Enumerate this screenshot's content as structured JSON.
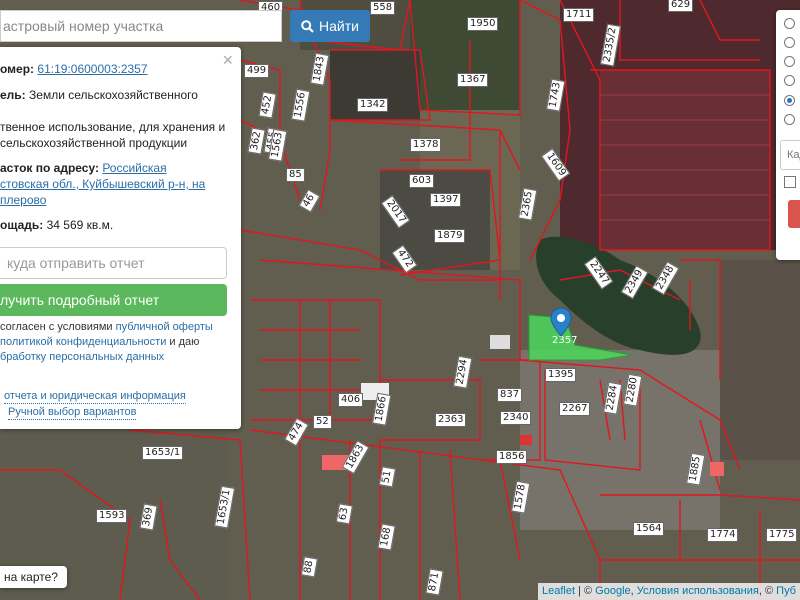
{
  "search": {
    "placeholder": "астровый номер участка",
    "button_label": "Найти"
  },
  "info": {
    "number_label": "омер:",
    "number_value": "61:19:0600003:2357",
    "purpose_label": "ель:",
    "purpose_value": "Земли сельскохозяйственного",
    "usage_line1": "твенное использование, для хранения и",
    "usage_line2": "сельскохозяйственной продукции",
    "address_label": "асток по адресу:",
    "address_l1": "Российская",
    "address_l2": "стовская обл., Куйбышевский р-н, на",
    "address_l3": "плерово",
    "area_label": "ощадь:",
    "area_value": "34 569 кв.м.",
    "email_placeholder": "куда отправить отчет",
    "report_button": "лучить подробный отчет",
    "agree_1a": "согласен с условиями ",
    "agree_1b": "публичной оферты",
    "agree_2a": "политикой конфиденциальности",
    "agree_2b": " и даю",
    "agree_3": "бработку персональных данных",
    "link_legal": "отчета и юридическая информация",
    "link_manual": "Ручной выбор вариантов"
  },
  "right_panel": {
    "input_placeholder": "Кад"
  },
  "bottom": {
    "where_label": "на карте?",
    "attr_leaflet": "Leaflet",
    "attr_google": "Google",
    "attr_terms": "Условия использования",
    "attr_pub": "Пуб"
  },
  "map": {
    "selected_plot": "2357",
    "plots": [
      {
        "t": "460",
        "s": "h"
      },
      {
        "t": "558",
        "s": "h"
      },
      {
        "t": "1950",
        "s": "h"
      },
      {
        "t": "1711",
        "s": "h"
      },
      {
        "t": "629",
        "s": "h"
      },
      {
        "t": "499",
        "s": "h"
      },
      {
        "t": "1843",
        "s": "v"
      },
      {
        "t": "1367",
        "s": "h"
      },
      {
        "t": "2335/2",
        "s": "v"
      },
      {
        "t": "1342",
        "s": "h"
      },
      {
        "t": "452",
        "s": "v"
      },
      {
        "t": "1556",
        "s": "v"
      },
      {
        "t": "1743",
        "s": "v"
      },
      {
        "t": "362",
        "s": "v"
      },
      {
        "t": "455",
        "s": "v"
      },
      {
        "t": "1563",
        "s": "v"
      },
      {
        "t": "1378",
        "s": "h"
      },
      {
        "t": "1609",
        "s": "d2"
      },
      {
        "t": "85",
        "s": "h"
      },
      {
        "t": "603",
        "s": "h"
      },
      {
        "t": "46",
        "s": "d"
      },
      {
        "t": "1397",
        "s": "h"
      },
      {
        "t": "2365",
        "s": "v"
      },
      {
        "t": "2017",
        "s": "d2"
      },
      {
        "t": "1879",
        "s": "h"
      },
      {
        "t": "472",
        "s": "d2"
      },
      {
        "t": "2247",
        "s": "d2"
      },
      {
        "t": "2349",
        "s": "d"
      },
      {
        "t": "2348",
        "s": "d"
      },
      {
        "t": "2294",
        "s": "v"
      },
      {
        "t": "1395",
        "s": "h"
      },
      {
        "t": "837",
        "s": "h"
      },
      {
        "t": "406",
        "s": "h"
      },
      {
        "t": "1866",
        "s": "v"
      },
      {
        "t": "2284",
        "s": "v"
      },
      {
        "t": "2280",
        "s": "v"
      },
      {
        "t": "2267",
        "s": "h"
      },
      {
        "t": "52",
        "s": "h"
      },
      {
        "t": "474",
        "s": "d"
      },
      {
        "t": "2363",
        "s": "h"
      },
      {
        "t": "2340",
        "s": "h"
      },
      {
        "t": "1653/1",
        "s": "h"
      },
      {
        "t": "1863",
        "s": "d"
      },
      {
        "t": "1856",
        "s": "h"
      },
      {
        "t": "1885",
        "s": "v"
      },
      {
        "t": "1593",
        "s": "h"
      },
      {
        "t": "369",
        "s": "v"
      },
      {
        "t": "1653/1",
        "s": "v"
      },
      {
        "t": "63",
        "s": "v"
      },
      {
        "t": "1578",
        "s": "v"
      },
      {
        "t": "1564",
        "s": "h"
      },
      {
        "t": "1774",
        "s": "h"
      },
      {
        "t": "1775",
        "s": "h"
      },
      {
        "t": "871",
        "s": "v"
      },
      {
        "t": "88",
        "s": "v"
      },
      {
        "t": "51",
        "s": "v"
      },
      {
        "t": "168",
        "s": "v"
      }
    ]
  }
}
